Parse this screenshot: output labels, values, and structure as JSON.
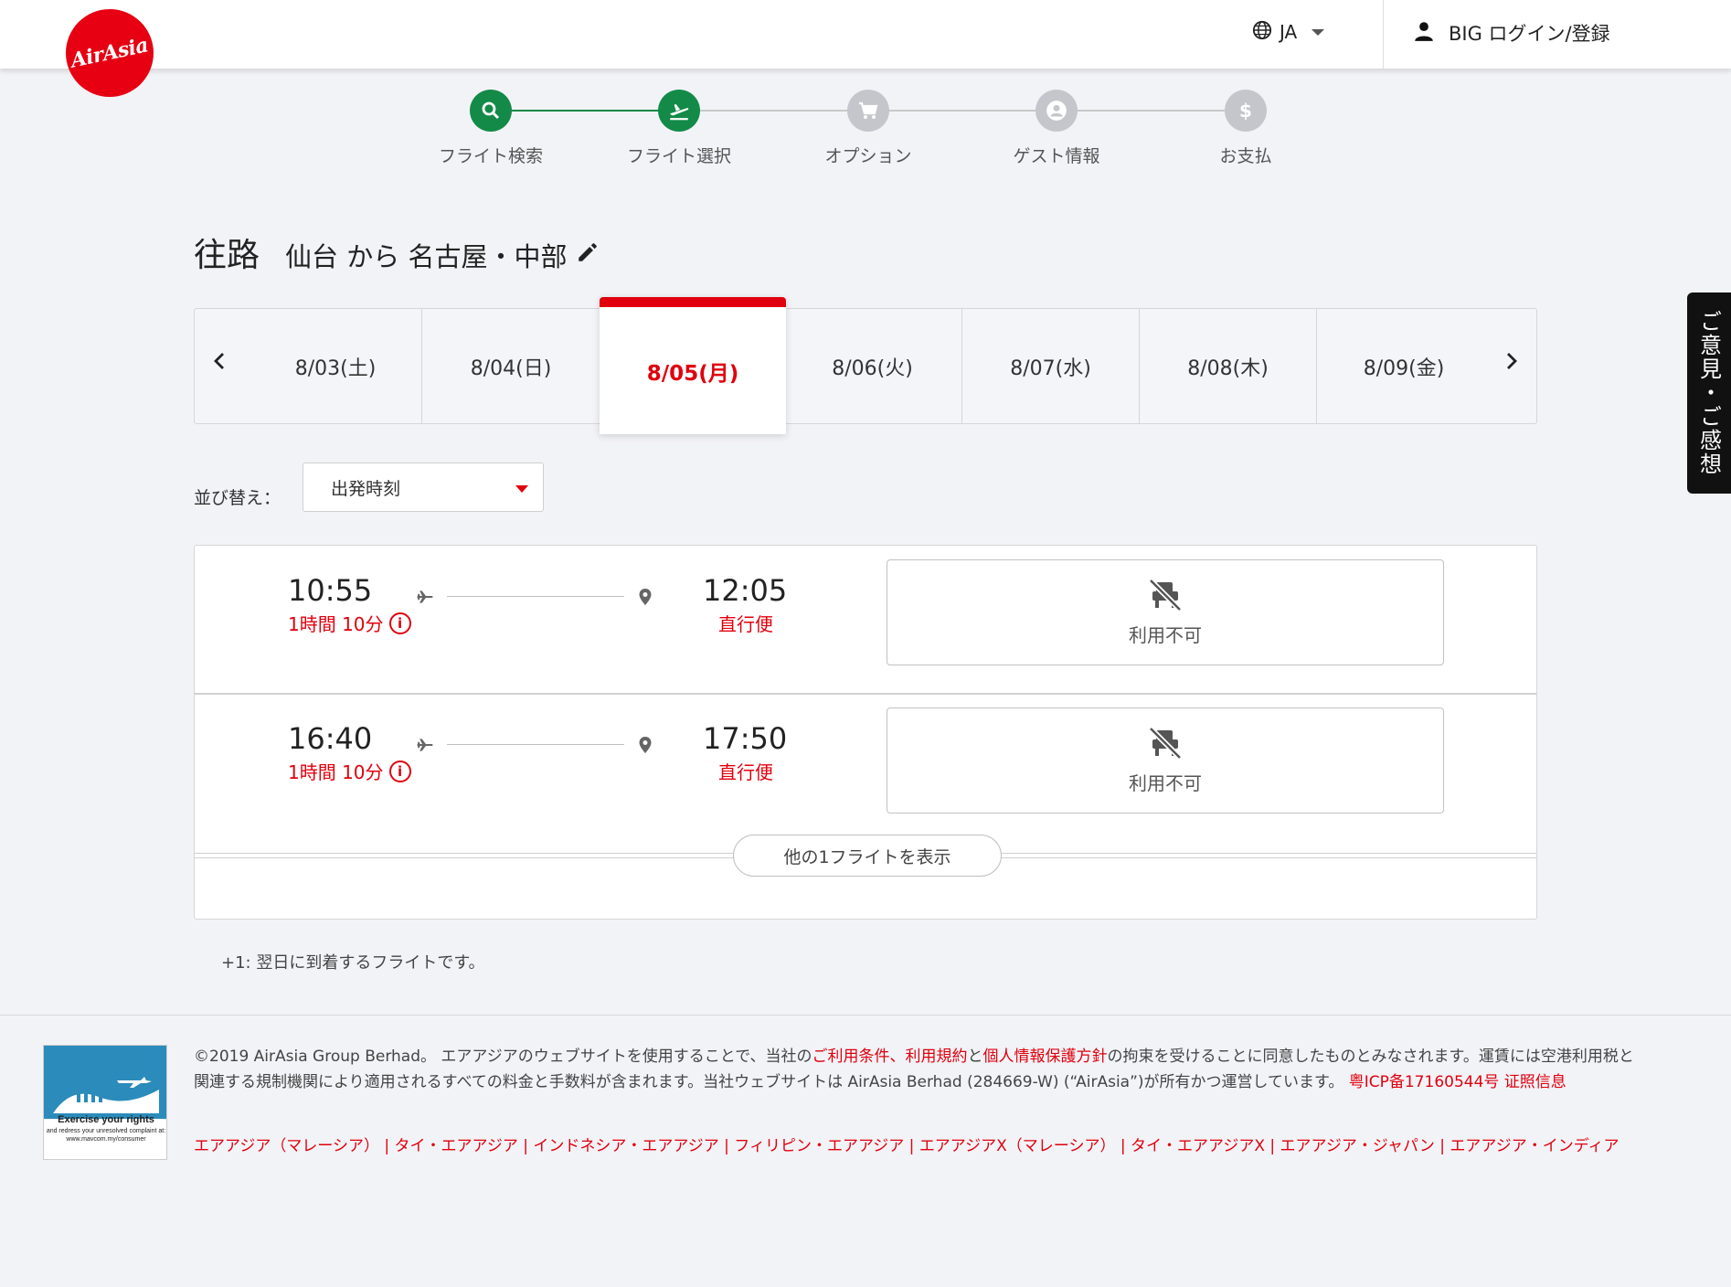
{
  "header": {
    "logo_text": "AirAsia",
    "language": "JA",
    "login_label": "BIG ログイン/登録"
  },
  "stepper": {
    "steps": [
      {
        "label": "フライト検索",
        "icon": "search-icon",
        "state": "done"
      },
      {
        "label": "フライト選択",
        "icon": "plane-takeoff-icon",
        "state": "active"
      },
      {
        "label": "オプション",
        "icon": "cart-icon",
        "state": "pending"
      },
      {
        "label": "ゲスト情報",
        "icon": "person-icon",
        "state": "pending"
      },
      {
        "label": "お支払",
        "icon": "dollar-icon",
        "state": "pending"
      }
    ]
  },
  "title": {
    "direction": "往路",
    "route": "仙台 から 名古屋・中部"
  },
  "dates": {
    "items": [
      "8/03(土)",
      "8/04(日)",
      "8/05(月)",
      "8/06(火)",
      "8/07(水)",
      "8/08(木)",
      "8/09(金)"
    ],
    "selected": "8/05(月)"
  },
  "sort": {
    "label": "並び替え：",
    "value": "出発時刻"
  },
  "flights": [
    {
      "depart": "10:55",
      "arrive": "12:05",
      "duration": "1時間 10分",
      "type": "直行便",
      "status": "利用不可"
    },
    {
      "depart": "16:40",
      "arrive": "17:50",
      "duration": "1時間 10分",
      "type": "直行便",
      "status": "利用不可"
    }
  ],
  "more_flights_label": "他の1フライトを表示",
  "note": "+1: 翌日に到着するフライトです。",
  "feedback_label": "ご意見・ご感想",
  "footer": {
    "badge_title": "Exercise your rights",
    "badge_sub": "and redress your unresolved complaint at: www.mavcom.my/consumer",
    "copyright_1": "©2019 AirAsia Group Berhad。 エアアジアのウェブサイトを使用することで、当社の",
    "link_terms": "ご利用条件",
    "sep_1": "、",
    "link_rules": "利用規約",
    "sep_2": "と",
    "link_privacy": "個人情報保護方針",
    "copyright_2": "の拘束を受けることに同意したものとみなされます。運賃には空港利用税と関連する規制機関により適用されるすべての料金と手数料が含まれます。当社ウェブサイトは AirAsia Berhad (284669-W) (“AirAsia”)が所有かつ運営しています。",
    "link_icp": "粤ICP备17160544号 证照信息",
    "links": [
      "エアアジア（マレーシア）",
      "タイ・エアアジア",
      "インドネシア・エアアジア",
      "フィリピン・エアアジア",
      "エアアジアX（マレーシア）",
      "タイ・エアアジアX",
      "エアアジア・ジャパン",
      "エアアジア・インディア"
    ]
  },
  "colors": {
    "brand_red": "#e0000d",
    "step_green": "#138a48",
    "background": "#f2f3f7"
  }
}
